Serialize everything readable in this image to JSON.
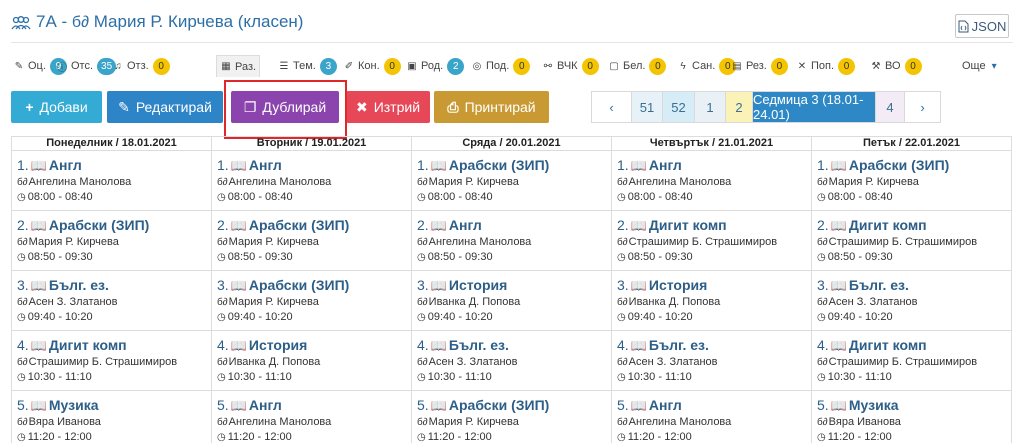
{
  "header": {
    "icon": "users-icon",
    "title": "7А - ",
    "teacher_glyph": "б∂",
    "teacher": " Мария Р. Кирчева (класен)",
    "json_label": "JSON"
  },
  "tabs": [
    {
      "icon": "pencil-icon",
      "label": "Оц.",
      "badge": "9",
      "badge_color": "#3aa5c9",
      "active": false
    },
    {
      "icon": "info-circle-icon",
      "label": "Отс.",
      "badge": "35",
      "badge_color": "#3aa5c9",
      "active": false
    },
    {
      "icon": "bell-icon",
      "label": "Отз.",
      "badge": "0",
      "badge_color": "#f5c400",
      "active": false
    },
    {
      "icon": "table-icon",
      "label": "Раз.",
      "badge": "",
      "badge_color": "",
      "active": true
    },
    {
      "icon": "list-icon",
      "label": "Тем.",
      "badge": "3",
      "badge_color": "#3aa5c9",
      "active": false
    },
    {
      "icon": "edit-icon",
      "label": "Кон.",
      "badge": "0",
      "badge_color": "#f5c400",
      "active": false
    },
    {
      "icon": "calendar-icon",
      "label": "Род.",
      "badge": "2",
      "badge_color": "#3aa5c9",
      "active": false
    },
    {
      "icon": "eye-slash-icon",
      "label": "Под.",
      "badge": "0",
      "badge_color": "#f5c400",
      "active": false
    },
    {
      "icon": "users-icon",
      "label": "ВЧК",
      "badge": "0",
      "badge_color": "#f5c400",
      "active": false
    },
    {
      "icon": "note-icon",
      "label": "Бел.",
      "badge": "0",
      "badge_color": "#f5c400",
      "active": false
    },
    {
      "icon": "bolt-icon",
      "label": "Сан.",
      "badge": "0",
      "badge_color": "#f5c400",
      "active": false
    },
    {
      "icon": "file-icon",
      "label": "Рез.",
      "badge": "0",
      "badge_color": "#f5c400",
      "active": false
    },
    {
      "icon": "tools-icon",
      "label": "Поп.",
      "badge": "0",
      "badge_color": "#f5c400",
      "active": false
    },
    {
      "icon": "hammer-icon",
      "label": "ВО",
      "badge": "0",
      "badge_color": "#f5c400",
      "active": false
    }
  ],
  "more_label": "Още",
  "actions": [
    {
      "name": "add-button",
      "icon": "+",
      "label": "Добави",
      "color": "#33abd4"
    },
    {
      "name": "edit-button",
      "icon": "✎",
      "label": "Редактирай",
      "color": "#2d84c7"
    },
    {
      "name": "duplicate-button",
      "icon": "❐",
      "label": "Дублирай",
      "color": "#8b44ad"
    },
    {
      "name": "delete-button",
      "icon": "✖",
      "label": "Изтрий",
      "color": "#e74858"
    },
    {
      "name": "print-button",
      "icon": "⎙",
      "label": "Принтирай",
      "color": "#c99a33"
    }
  ],
  "pager": {
    "prev": "‹",
    "items": [
      {
        "label": "51",
        "bg": "#e7f2f8",
        "color": "#3a6f93"
      },
      {
        "label": "52",
        "bg": "#d6edf7",
        "color": "#3a6f93"
      },
      {
        "label": "1",
        "bg": "#e9f0f6",
        "color": "#3a6f93"
      },
      {
        "label": "2",
        "bg": "#fbf2b8",
        "color": "#3a6f93"
      },
      {
        "label": "Седмица 3 (18.01-24.01)",
        "bg": "#2e88c6",
        "color": "#ffffff"
      },
      {
        "label": "4",
        "bg": "#f3ecf7",
        "color": "#3a6f93"
      }
    ],
    "next": "›"
  },
  "days": [
    {
      "header": "Понеделник / 18.01.2021",
      "lessons": [
        {
          "num": "1.",
          "subject": "Англ",
          "teacher": "Ангелина Манолова",
          "time": "08:00 - 08:40"
        },
        {
          "num": "2.",
          "subject": "Арабски (ЗИП)",
          "teacher": "Мария Р. Кирчева",
          "time": "08:50 - 09:30"
        },
        {
          "num": "3.",
          "subject": "Бълг. ез.",
          "teacher": "Асен З. Златанов",
          "time": "09:40 - 10:20"
        },
        {
          "num": "4.",
          "subject": "Дигит комп",
          "teacher": "Страшимир Б. Страшимиров",
          "time": "10:30 - 11:10"
        },
        {
          "num": "5.",
          "subject": "Музика",
          "teacher": "Вяра Иванова",
          "time": "11:20 - 12:00"
        }
      ]
    },
    {
      "header": "Вторник / 19.01.2021",
      "lessons": [
        {
          "num": "1.",
          "subject": "Англ",
          "teacher": "Ангелина Манолова",
          "time": "08:00 - 08:40"
        },
        {
          "num": "2.",
          "subject": "Арабски (ЗИП)",
          "teacher": "Мария Р. Кирчева",
          "time": "08:50 - 09:30"
        },
        {
          "num": "3.",
          "subject": "Арабски (ЗИП)",
          "teacher": "Мария Р. Кирчева",
          "time": "09:40 - 10:20"
        },
        {
          "num": "4.",
          "subject": "История",
          "teacher": "Иванка Д. Попова",
          "time": "10:30 - 11:10"
        },
        {
          "num": "5.",
          "subject": "Англ",
          "teacher": "Ангелина Манолова",
          "time": "11:20 - 12:00"
        }
      ]
    },
    {
      "header": "Сряда / 20.01.2021",
      "lessons": [
        {
          "num": "1.",
          "subject": "Арабски (ЗИП)",
          "teacher": "Мария Р. Кирчева",
          "time": "08:00 - 08:40"
        },
        {
          "num": "2.",
          "subject": "Англ",
          "teacher": "Ангелина Манолова",
          "time": "08:50 - 09:30"
        },
        {
          "num": "3.",
          "subject": "История",
          "teacher": "Иванка Д. Попова",
          "time": "09:40 - 10:20"
        },
        {
          "num": "4.",
          "subject": "Бълг. ез.",
          "teacher": "Асен З. Златанов",
          "time": "10:30 - 11:10"
        },
        {
          "num": "5.",
          "subject": "Арабски (ЗИП)",
          "teacher": "Мария Р. Кирчева",
          "time": "11:20 - 12:00"
        }
      ]
    },
    {
      "header": "Четвъртък / 21.01.2021",
      "lessons": [
        {
          "num": "1.",
          "subject": "Англ",
          "teacher": "Ангелина Манолова",
          "time": "08:00 - 08:40"
        },
        {
          "num": "2.",
          "subject": "Дигит комп",
          "teacher": "Страшимир Б. Страшимиров",
          "time": "08:50 - 09:30"
        },
        {
          "num": "3.",
          "subject": "История",
          "teacher": "Иванка Д. Попова",
          "time": "09:40 - 10:20"
        },
        {
          "num": "4.",
          "subject": "Бълг. ез.",
          "teacher": "Асен З. Златанов",
          "time": "10:30 - 11:10"
        },
        {
          "num": "5.",
          "subject": "Англ",
          "teacher": "Ангелина Манолова",
          "time": "11:20 - 12:00"
        }
      ]
    },
    {
      "header": "Петък / 22.01.2021",
      "lessons": [
        {
          "num": "1.",
          "subject": "Арабски (ЗИП)",
          "teacher": "Мария Р. Кирчева",
          "time": "08:00 - 08:40"
        },
        {
          "num": "2.",
          "subject": "Дигит комп",
          "teacher": "Страшимир Б. Страшимиров",
          "time": "08:50 - 09:30"
        },
        {
          "num": "3.",
          "subject": "Бълг. ез.",
          "teacher": "Асен З. Златанов",
          "time": "09:40 - 10:20"
        },
        {
          "num": "4.",
          "subject": "Дигит комп",
          "teacher": "Страшимир Б. Страшимиров",
          "time": "10:30 - 11:10"
        },
        {
          "num": "5.",
          "subject": "Музика",
          "teacher": "Вяра Иванова",
          "time": "11:20 - 12:00"
        }
      ]
    }
  ],
  "lesson_icons": {
    "book": "book-icon",
    "teacher": "teacher-icon",
    "time": "clock-icon"
  }
}
